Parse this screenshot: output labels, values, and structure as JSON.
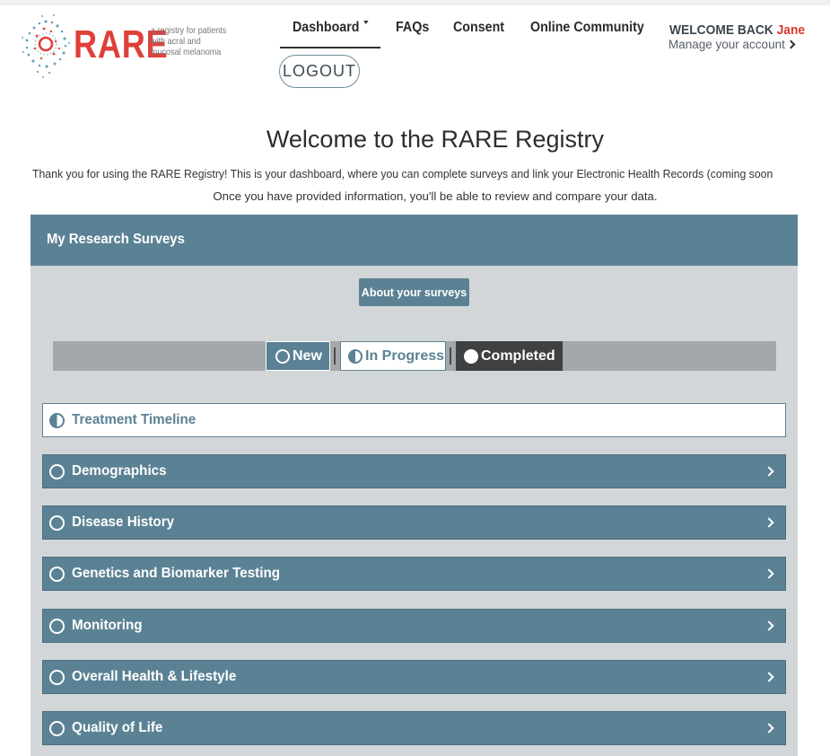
{
  "logo": {
    "wordmark": "RARE",
    "tagline": "a registry for patients with acral and mucosal melanoma",
    "brand_color": "#e0403a"
  },
  "nav": {
    "dashboard": "Dashboard",
    "faqs": "FAQs",
    "consent": "Consent",
    "community": "Online Community",
    "logout": "LOGOUT"
  },
  "account": {
    "welcome": "WELCOME BACK",
    "name": "Jane",
    "manage": "Manage your account"
  },
  "page": {
    "title": "Welcome to the RARE Registry",
    "intro_line1": "Thank you for using the RARE Registry! This is your dashboard, where you can complete surveys and link your Electronic Health Records (coming soon",
    "intro_line2": "Once you have provided information, you'll be able to review and compare your data."
  },
  "panel": {
    "title": "My Research Surveys",
    "about_button": "About your surveys",
    "accent_color": "#5b8294"
  },
  "legend": {
    "new": "New",
    "in_progress": "In Progress",
    "completed": "Completed"
  },
  "surveys": [
    {
      "label": "Treatment Timeline",
      "status": "in-progress"
    },
    {
      "label": "Demographics",
      "status": "new"
    },
    {
      "label": "Disease History",
      "status": "new"
    },
    {
      "label": "Genetics and Biomarker Testing",
      "status": "new"
    },
    {
      "label": "Monitoring",
      "status": "new"
    },
    {
      "label": "Overall Health & Lifestyle",
      "status": "new"
    },
    {
      "label": "Quality of Life",
      "status": "new"
    }
  ],
  "icons": [
    "dots-circle-logo-icon",
    "caret-down-icon",
    "chevron-right-icon",
    "empty-circle-icon",
    "half-circle-icon",
    "full-circle-icon"
  ]
}
